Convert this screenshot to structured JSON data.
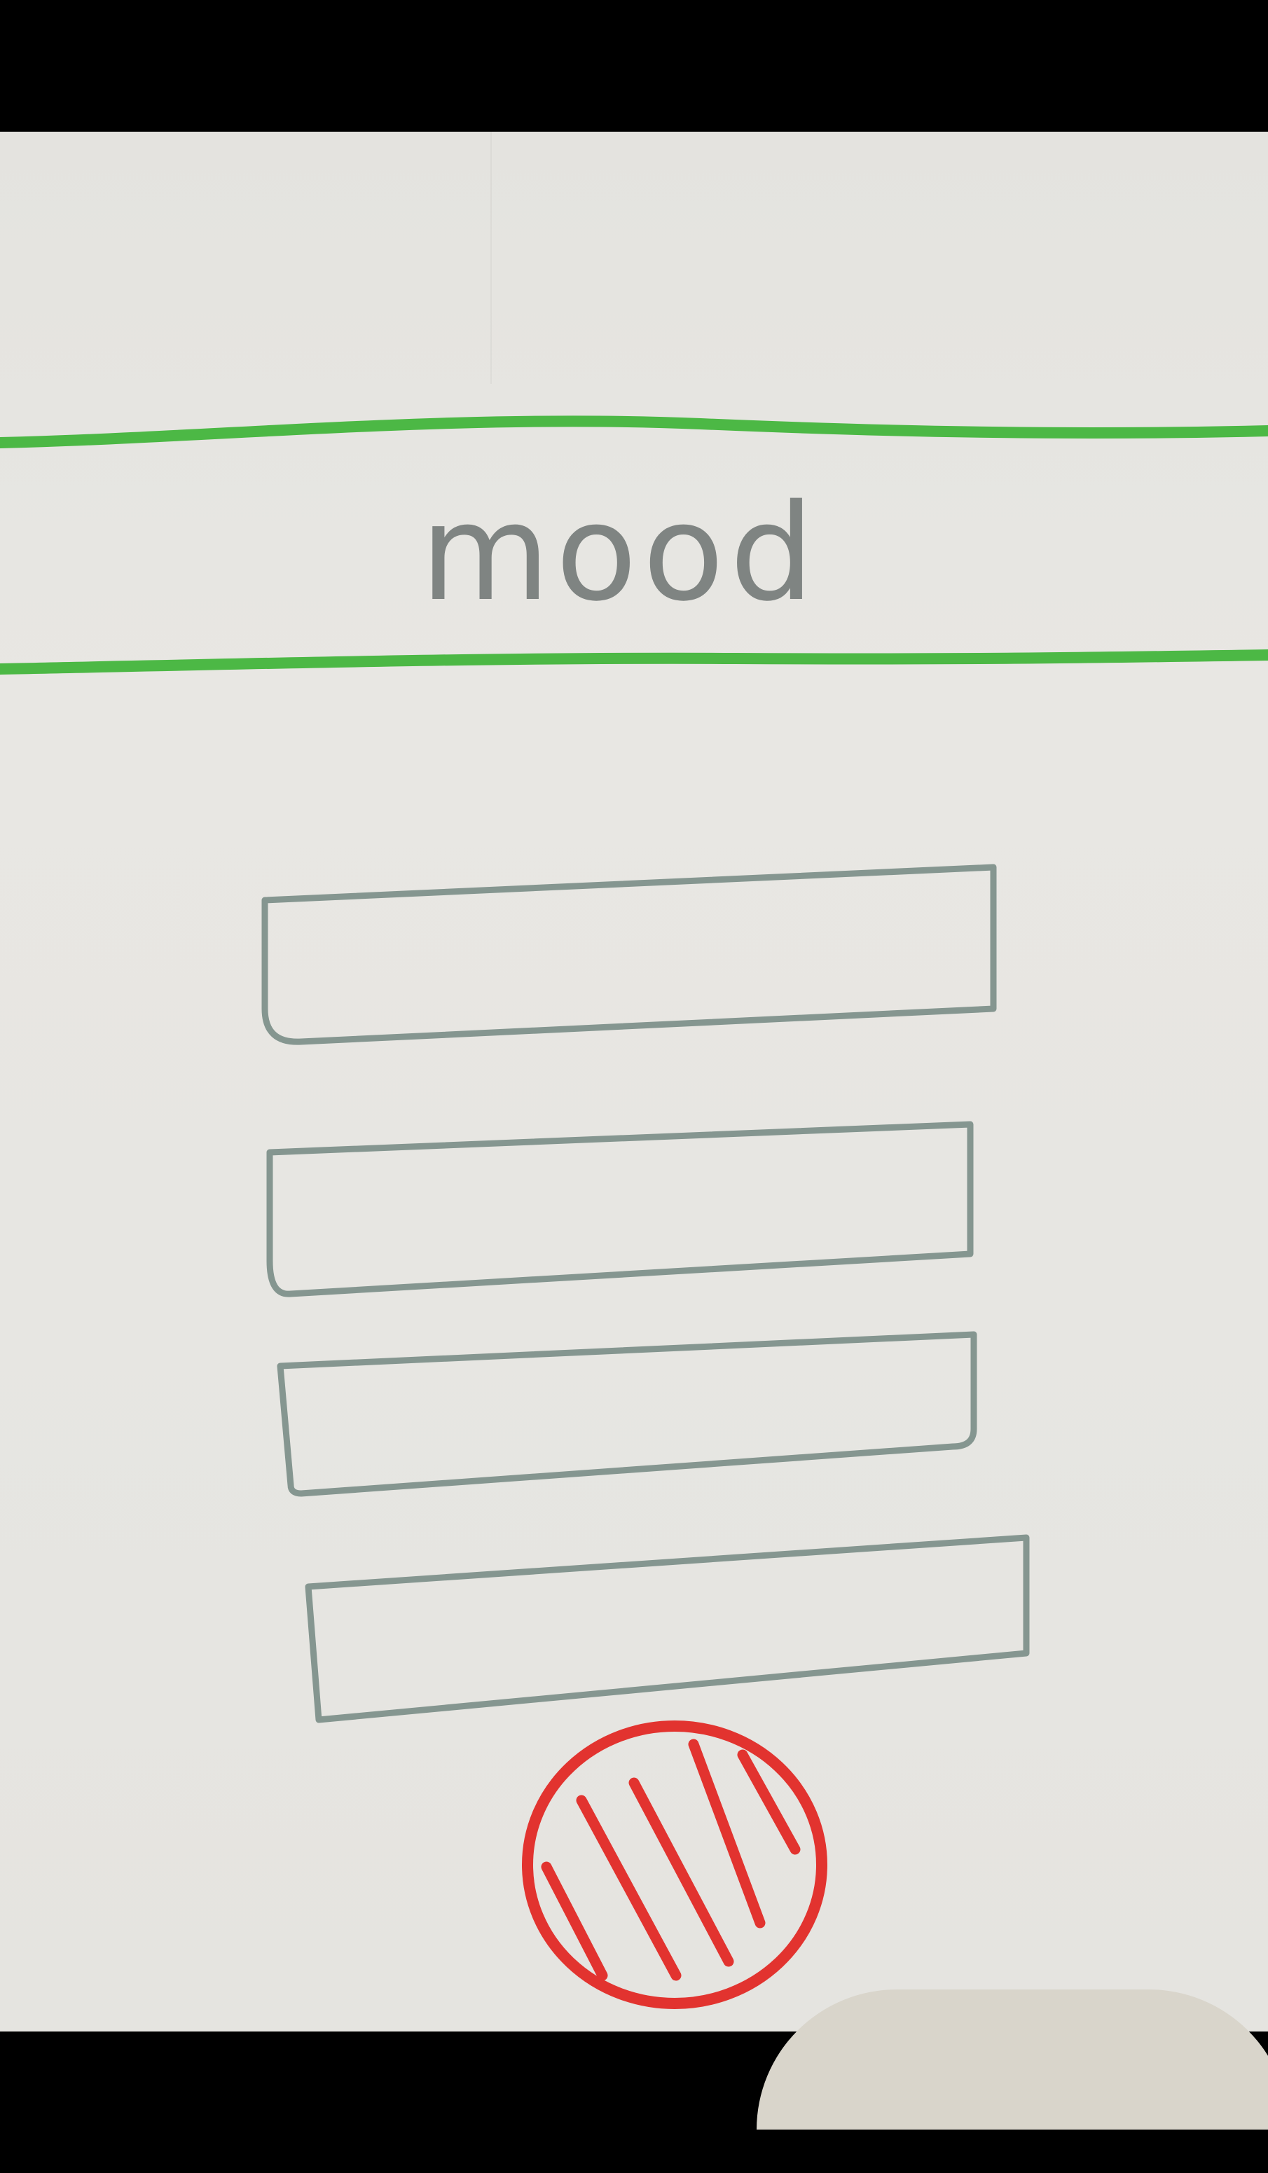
{
  "app": {
    "title": "mood"
  },
  "colors": {
    "paper": "#e7e6e2",
    "header_lines": "#4cb845",
    "title_text": "#7f8482",
    "box_outline": "#8a9a91",
    "record_button": "#e2332f"
  },
  "header": {
    "title": "mood"
  },
  "options": {
    "count": 4
  },
  "record_button": {
    "icon": "hatched-circle-icon"
  }
}
